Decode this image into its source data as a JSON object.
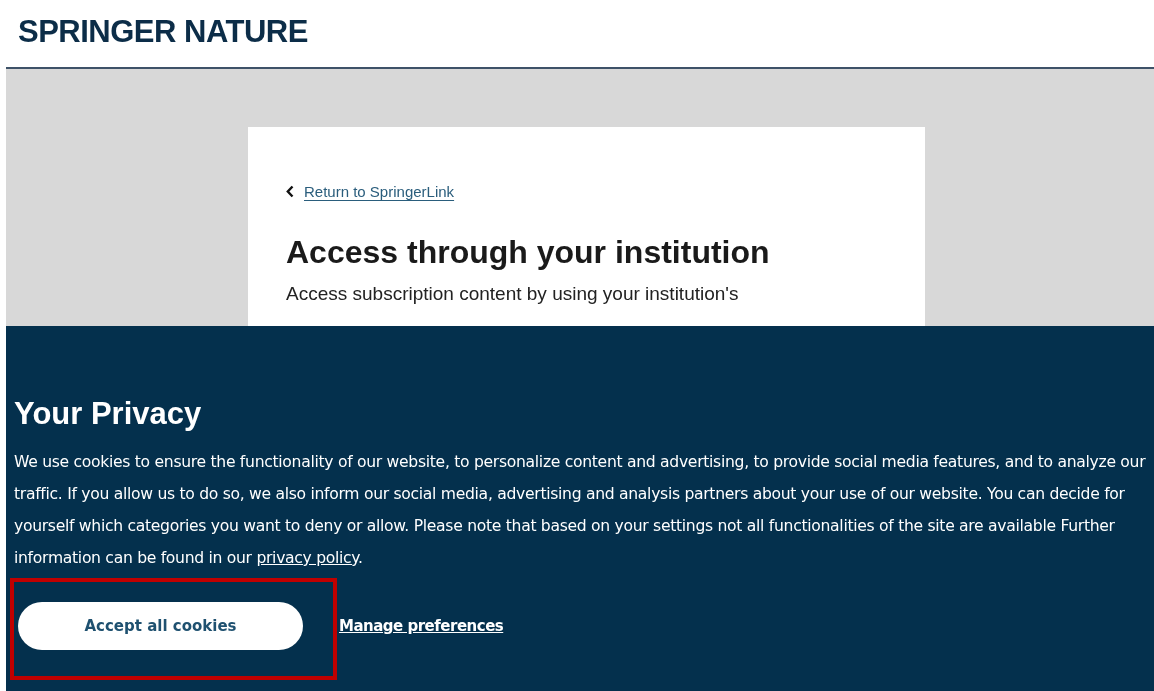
{
  "header": {
    "logo": "SPRINGER NATURE"
  },
  "card": {
    "back_link": "Return to SpringerLink",
    "title": "Access through your institution",
    "intro": "Access subscription content by using your institution's"
  },
  "cookie_banner": {
    "title": "Your Privacy",
    "text": "We use cookies to ensure the functionality of our website, to personalize content and advertising, to provide social media features, and to analyze our traffic. If you allow us to do so, we also inform our social media, advertising and analysis partners about your use of our website. You can decide for yourself which categories you want to deny or allow. Please note that based on your settings not all functionalities of the site are available Further information can be found in our ",
    "policy_link": "privacy policy",
    "text_end": ".",
    "accept_button": {
      "label": "Accept all cookies",
      "highlighted": true
    },
    "manage_link": "Manage preferences"
  }
}
